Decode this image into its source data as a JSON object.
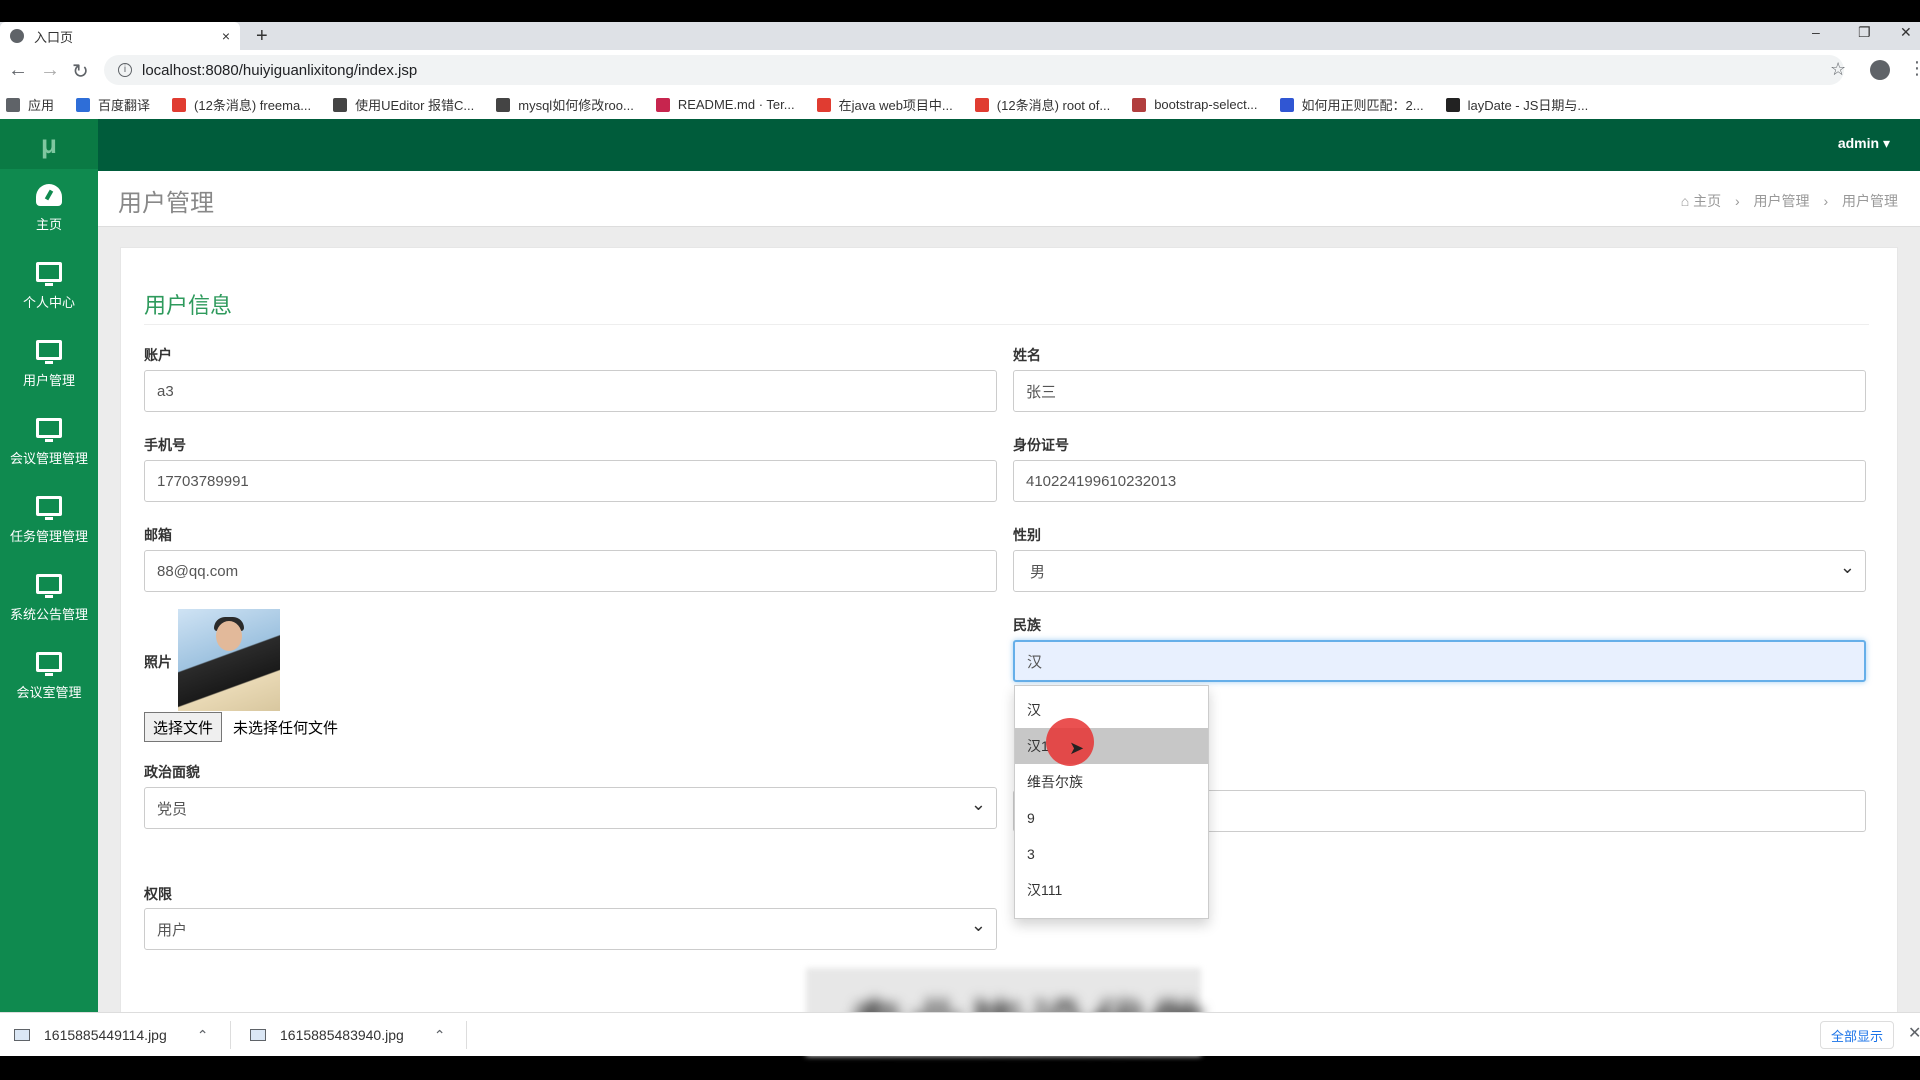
{
  "browser": {
    "tab_title": "入口页",
    "tab_close": "×",
    "new_tab": "+",
    "window_controls": {
      "minimize": "–",
      "restore": "❐",
      "close": "✕"
    },
    "url": "localhost:8080/huiyiguanlixitong/index.jsp",
    "bookmarks": [
      {
        "label": "应用",
        "color": "#5f6368"
      },
      {
        "label": "百度翻译",
        "color": "#2e6ed8"
      },
      {
        "label": "(12条消息) freema...",
        "color": "#e03c31"
      },
      {
        "label": "使用UEditor 报错C...",
        "color": "#444444"
      },
      {
        "label": "mysql如何修改roo...",
        "color": "#444444"
      },
      {
        "label": "README.md · Ter...",
        "color": "#c7254e"
      },
      {
        "label": "在java web项目中...",
        "color": "#e03c31"
      },
      {
        "label": "(12条消息) root of...",
        "color": "#e03c31"
      },
      {
        "label": "bootstrap-select...",
        "color": "#b13e3e"
      },
      {
        "label": "如何用正则匹配：2...",
        "color": "#3056d3"
      },
      {
        "label": "layDate - JS日期与...",
        "color": "#222222"
      }
    ]
  },
  "sidebar": {
    "logo": "μ",
    "items": [
      {
        "label": "主页",
        "icon": "dashboard-icon"
      },
      {
        "label": "个人中心",
        "icon": "monitor-icon"
      },
      {
        "label": "用户管理",
        "icon": "monitor-icon"
      },
      {
        "label": "会议管理管理",
        "icon": "monitor-icon"
      },
      {
        "label": "任务管理管理",
        "icon": "monitor-icon"
      },
      {
        "label": "系统公告管理",
        "icon": "monitor-icon"
      },
      {
        "label": "会议室管理",
        "icon": "monitor-icon"
      }
    ]
  },
  "topnav": {
    "user": "admin ▾"
  },
  "page": {
    "title": "用户管理",
    "breadcrumb": [
      "主页",
      "用户管理",
      "用户管理"
    ],
    "breadcrumb_sep": "›",
    "home_icon": "⌂"
  },
  "form": {
    "panel_title": "用户信息",
    "account": {
      "label": "账户",
      "value": "a3"
    },
    "name": {
      "label": "姓名",
      "value": "张三"
    },
    "phone": {
      "label": "手机号",
      "value": "17703789991"
    },
    "idcard": {
      "label": "身份证号",
      "value": "410224199610232013"
    },
    "email": {
      "label": "邮箱",
      "value": "88@qq.com"
    },
    "gender": {
      "label": "性别",
      "value": "男"
    },
    "photo": {
      "label": "照片",
      "file_button": "选择文件",
      "file_status": "未选择任何文件"
    },
    "ethnicity": {
      "label": "民族",
      "value": "汉",
      "options": [
        "汉",
        "汉1",
        "维吾尔族",
        "9",
        "3",
        "汉111"
      ],
      "highlighted_index": 1
    },
    "politics": {
      "label": "政治面貌",
      "value": "党员"
    },
    "role": {
      "label": "权限",
      "value": "用户"
    }
  },
  "overlay_text": "专业毕设代做",
  "downloads": {
    "files": [
      "1615885449114.jpg",
      "1615885483940.jpg"
    ],
    "chevron": "⌃",
    "show_all": "全部显示",
    "close": "✕"
  },
  "colors": {
    "sidebar": "#0f8a4f",
    "topnav": "#005c3b",
    "panel_title": "#2e9a5c",
    "focus_border": "#66afe9"
  }
}
